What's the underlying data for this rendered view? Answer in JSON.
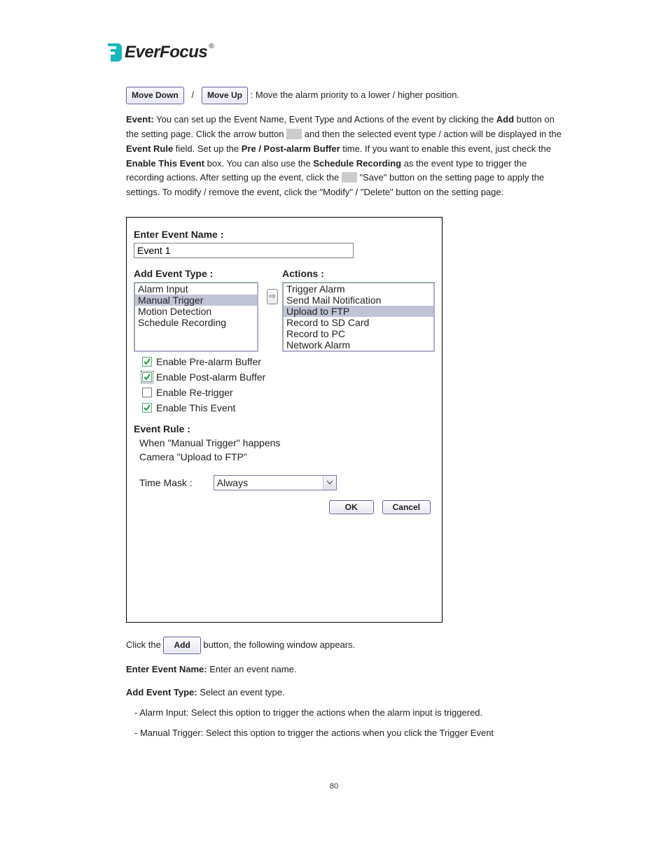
{
  "logo": {
    "text": "EverFocus",
    "registered": "®"
  },
  "para1": {
    "prefix": "",
    "btn_down": "Move Down",
    "mid": "/",
    "btn_up": "Move Up",
    "tail": ": Move the alarm priority to a lower / higher position."
  },
  "para2": "Event: You can set up the Event Name, Event Type and Actions of the event by clicking the Add button on the setting page. Click the arrow button and then the selected event type / action will be displayed in the Event Rule field. Set up the Pre / Post-alarm Buffer time. If you want to enable this event, just check the Enable This Event box. You can also use the Schedule Recording as the event type to trigger the recording actions. After setting up the event, click the \"Save\" button on the setting page to apply the settings. To modify / remove the event, click the \"Modify\" / \"Delete\" button on the setting page.",
  "dialog": {
    "enter_name_label": "Enter Event Name :",
    "event_name": "Event 1",
    "add_event_type_label": "Add Event Type :",
    "actions_label": "Actions :",
    "event_types": [
      {
        "label": "Alarm Input",
        "selected": false
      },
      {
        "label": "Manual Trigger",
        "selected": true
      },
      {
        "label": "Motion Detection",
        "selected": false
      },
      {
        "label": "Schedule Recording",
        "selected": false
      }
    ],
    "actions": [
      {
        "label": "Trigger Alarm",
        "selected": false
      },
      {
        "label": "Send Mail Notification",
        "selected": false
      },
      {
        "label": "Upload to FTP",
        "selected": true
      },
      {
        "label": "Record to SD Card",
        "selected": false
      },
      {
        "label": "Record to PC",
        "selected": false
      },
      {
        "label": "Network Alarm",
        "selected": false
      }
    ],
    "arrow_glyph": "⇨",
    "chk_pre": "Enable Pre-alarm Buffer",
    "chk_post": "Enable Post-alarm Buffer",
    "chk_retrigger": "Enable Re-trigger",
    "chk_enable": "Enable This Event",
    "event_rule_label": "Event Rule :",
    "rule_line1": "When \"Manual Trigger\" happens",
    "rule_line2": "Camera \"Upload to FTP\"",
    "time_mask_label": "Time Mask :",
    "time_mask_value": "Always",
    "ok": "OK",
    "cancel": "Cancel"
  },
  "para3_pre": "Click the ",
  "para3_btn": "Add",
  "para3_post": " button, the following window appears.",
  "para4": "Enter Event Name: Enter an event name.",
  "para5": "Add Event Type: Select an event type.",
  "para6_a": "- Alarm Input: Select this option to trigger the actions when the alarm input is triggered.",
  "para6_b": "- Manual Trigger: Select this option to trigger the actions when you click the Trigger Event",
  "page_number": "80"
}
